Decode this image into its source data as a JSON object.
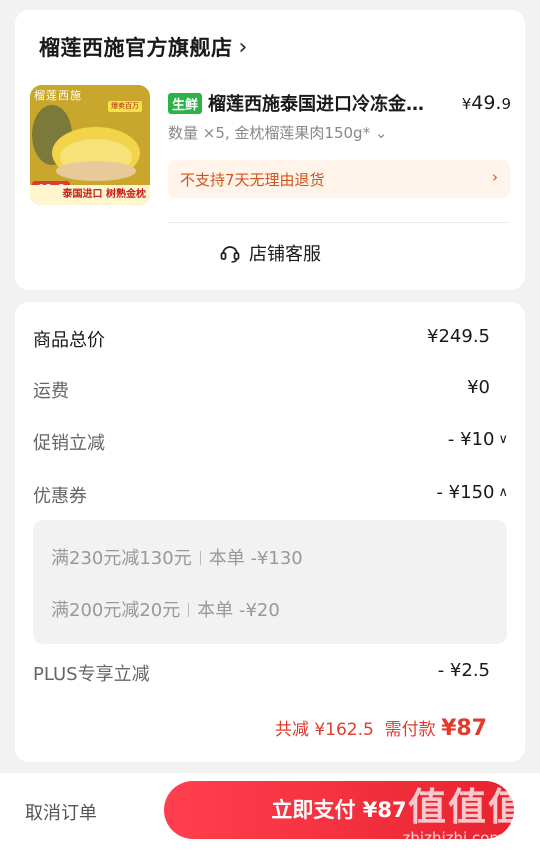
{
  "shop": {
    "name": "榴莲西施官方旗舰店",
    "chevron": "›"
  },
  "product": {
    "thumb_brand": "榴莲西施",
    "thumb_tag": "爆卖百万",
    "thumb_price": "49.9",
    "thumb_banner": "泰国进口 树熟金枕",
    "badge": "生鲜",
    "title": "榴莲西施泰国进口冷冻金枕榴莲果肉",
    "price_symbol": "¥",
    "price_int": "49.",
    "price_dec": "9",
    "spec": "数量 ×5, 金枕榴莲果肉150g* ⌄",
    "return_note": "不支持7天无理由退货",
    "return_arrow": "›"
  },
  "service": {
    "label": "店铺客服",
    "icon": "headset-icon"
  },
  "price_detail": {
    "goods_total_label": "商品总价",
    "goods_total": "¥249.5",
    "shipping_label": "运费",
    "shipping": "¥0",
    "promo_label": "促销立减",
    "promo": "- ¥10",
    "coupon_label": "优惠券",
    "coupon": "- ¥150",
    "coupons": [
      {
        "name": "满230元减130元",
        "value": "本单 -¥130"
      },
      {
        "name": "满200元减20元",
        "value": "本单 -¥20"
      }
    ],
    "plus_label": "PLUS专享立减",
    "plus": "- ¥2.5",
    "total_off_label": "共减",
    "total_off": "¥162.5",
    "need_pay_label": "需付款",
    "need_pay": "¥87"
  },
  "bottom": {
    "cancel": "取消订单",
    "pay": "立即支付 ¥87"
  },
  "watermark": {
    "text": "值值值",
    "domain": "zhizhizhi.com"
  },
  "colors": {
    "accent": "#e33a2e",
    "badge_green": "#2db24a",
    "note_bg": "#fff3ea"
  }
}
